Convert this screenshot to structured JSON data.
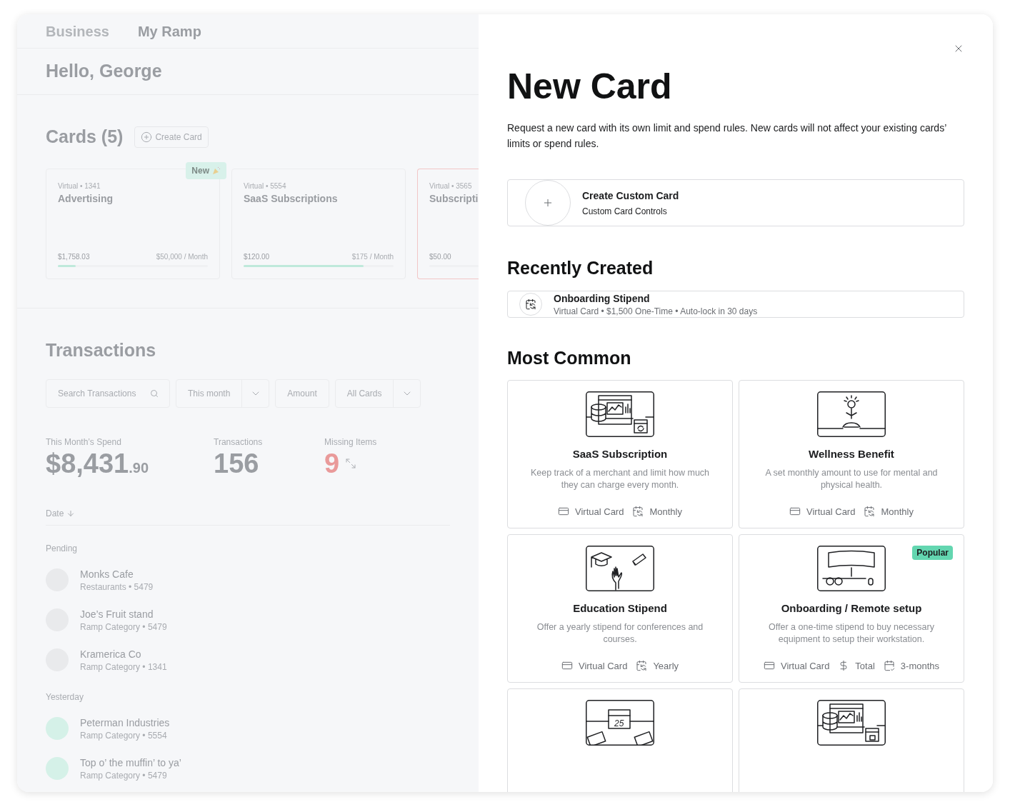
{
  "background": {
    "tabs": [
      {
        "label": "Business",
        "selected": false
      },
      {
        "label": "My Ramp",
        "selected": true
      }
    ],
    "greeting": "Hello, George",
    "cards_section": {
      "title": "Cards (5)",
      "create_button": "Create Card",
      "cards": [
        {
          "meta": "Virtual • 1341",
          "name": "Advertising",
          "spent": "$1,758.03",
          "limit": "$50,000 / Month",
          "level": 0.12,
          "badge": "New",
          "alert": false
        },
        {
          "meta": "Virtual • 5554",
          "name": "SaaS Subscriptions",
          "spent": "$120.00",
          "limit": "$175 / Month",
          "level": 0.8,
          "alert": false
        },
        {
          "meta": "Virtual • 3565",
          "name": "Subscripti",
          "spent": "$50.00",
          "alert": true
        }
      ]
    },
    "transactions": {
      "title": "Transactions",
      "search": {
        "placeholder": "Search Transactions"
      },
      "filters": [
        {
          "kind": "dropdown",
          "label": "This month"
        },
        {
          "kind": "button",
          "label": "Amount"
        },
        {
          "kind": "dropdown",
          "label": "All Cards"
        }
      ],
      "stats": [
        {
          "label": "This Month’s Spend",
          "value": "$8,431",
          "cents": ".90",
          "alert": false
        },
        {
          "label": "Transactions",
          "value": "156",
          "alert": false
        },
        {
          "label": "Missing Items",
          "value": "9",
          "alert": true
        }
      ],
      "sort_column": "Date",
      "groups": [
        {
          "label": "Pending",
          "rows": [
            {
              "merchant": "Monks Cafe",
              "detail": "Restaurants • 5479",
              "color": "#e9eaec"
            },
            {
              "merchant": "Joe’s Fruit stand",
              "detail": "Ramp Category • 5479",
              "color": "#e9eaec"
            },
            {
              "merchant": "Kramerica Co",
              "detail": "Ramp Category • 1341",
              "color": "#e9eaec"
            }
          ]
        },
        {
          "label": "Yesterday",
          "rows": [
            {
              "merchant": "Peterman Industries",
              "detail": "Ramp Category • 5554",
              "color": "#d5f1e8"
            },
            {
              "merchant": "Top o’ the muffin’ to ya’",
              "detail": "Ramp Category • 5479",
              "color": "#d5f1e8"
            }
          ]
        }
      ]
    }
  },
  "panel": {
    "title": "New Card",
    "description": "Request a new card with its own limit and spend rules. New cards will not affect your existing cards’ limits or spend rules.",
    "custom": {
      "title": "Create Custom Card",
      "subtitle": "Custom Card Controls"
    },
    "recent_title": "Recently Created",
    "recent": [
      {
        "title": "Onboarding Stipend",
        "details": "Virtual Card • $1,500 One-Time • Auto-lock in 30 days"
      }
    ],
    "common_title": "Most Common",
    "templates": [
      {
        "kind": "saas",
        "title": "SaaS Subscription",
        "description": "Keep track of a merchant and limit how much they can charge every month.",
        "tags": [
          {
            "kind": "card",
            "label": "Virtual Card"
          },
          {
            "kind": "recurring",
            "label": "Monthly"
          }
        ]
      },
      {
        "kind": "wellness",
        "title": "Wellness Benefit",
        "description": "A set monthly amount to use for mental and physical health.",
        "tags": [
          {
            "kind": "card",
            "label": "Virtual Card"
          },
          {
            "kind": "recurring",
            "label": "Monthly"
          }
        ]
      },
      {
        "kind": "education",
        "title": "Education Stipend",
        "description": "Offer a yearly stipend for conferences and courses.",
        "tags": [
          {
            "kind": "card",
            "label": "Virtual Card"
          },
          {
            "kind": "recurring",
            "label": "Yearly"
          }
        ]
      },
      {
        "kind": "remote",
        "title": "Onboarding / Remote setup",
        "description": "Offer a one-time stipend to buy necessary equipment to setup their workstation.",
        "badge": "Popular",
        "tags": [
          {
            "kind": "card",
            "label": "Virtual Card"
          },
          {
            "kind": "dollar",
            "label": "Total"
          },
          {
            "kind": "lock",
            "label": "3-months"
          }
        ]
      },
      {
        "kind": "calendar",
        "illustration_text": "25"
      },
      {
        "kind": "saas-lock"
      }
    ]
  }
}
